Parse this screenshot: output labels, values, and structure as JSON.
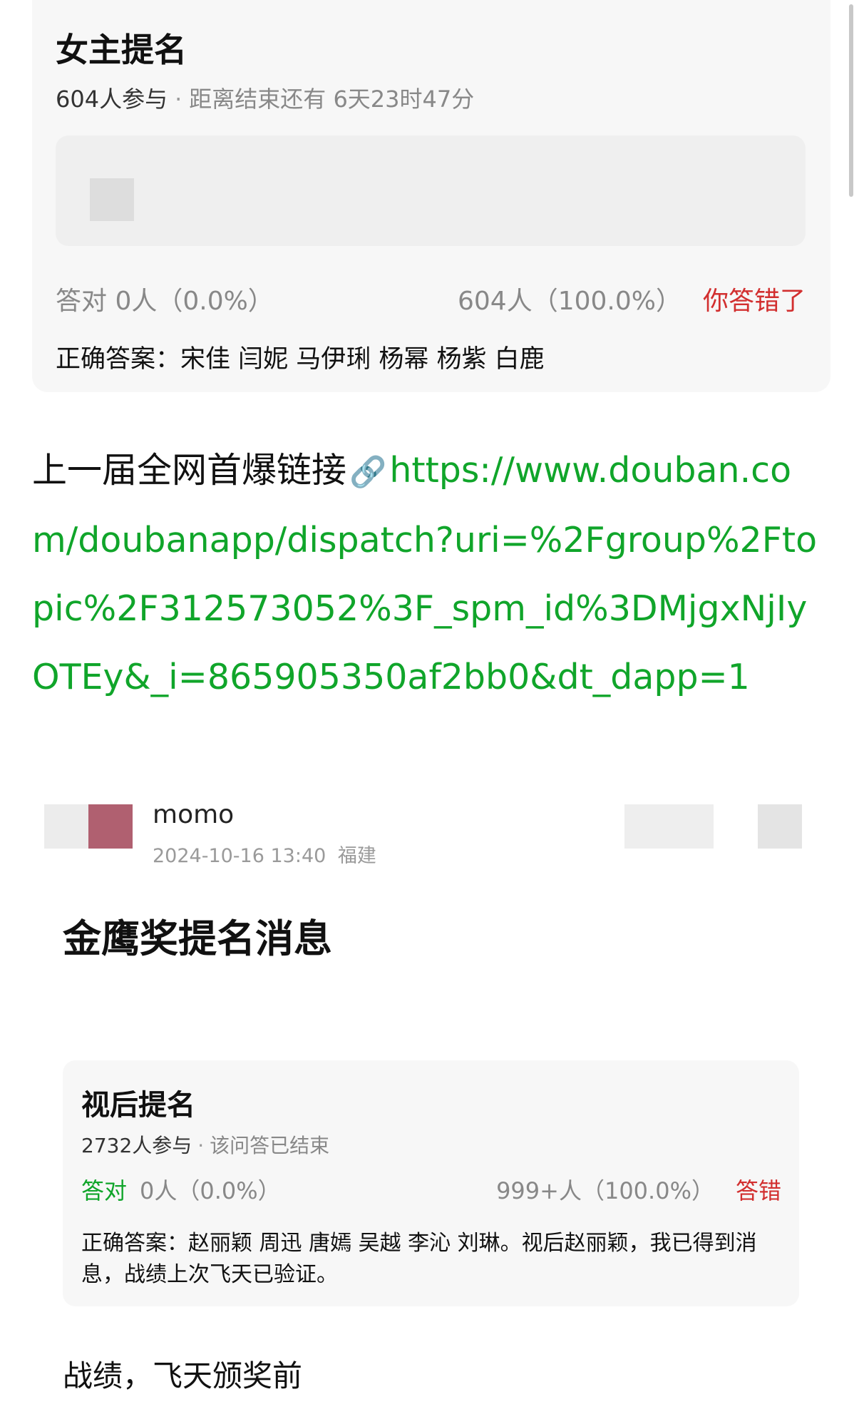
{
  "quiz1": {
    "title": "女主提名",
    "participants": "604人参与",
    "separator": "·",
    "ends_in": "距离结束还有 6天23时47分",
    "correct_stat": "答对  0人（0.0%）",
    "wrong_stat": "604人（100.0%）",
    "result": "你答错了",
    "answer": "正确答案：宋佳 闫妮 马伊琍 杨幂 杨紫 白鹿"
  },
  "link_paragraph": {
    "prefix": "上一届全网首爆链接",
    "link_icon": "🔗",
    "url": "https://www.douban.com/doubanapp/dispatch?uri=%2Fgroup%2Ftopic%2F312573052%3F_spm_id%3DMjgxNjIyOTEy&_i=865905350af2bb0&dt_dapp=1"
  },
  "post": {
    "username": "momo",
    "datetime": "2024-10-16 13:40",
    "location": "福建",
    "title": "金鹰奖提名消息"
  },
  "quiz2": {
    "title": "视后提名",
    "participants": "2732人参与",
    "separator": "·",
    "status": "该问答已结束",
    "correct_label": "答对",
    "correct_stat": "0人（0.0%）",
    "wrong_stat": "999+人（100.0%）",
    "result": "答错",
    "answer": "正确答案：赵丽颖 周迅 唐嫣 吴越 李沁 刘琳。视后赵丽颖，我已得到消息，战绩上次飞天已验证。"
  },
  "footer_text": "战绩，飞天颁奖前",
  "colors": {
    "link_green": "#10a52a",
    "wrong_red": "#d22f2f",
    "card_bg": "#f7f7f7"
  }
}
